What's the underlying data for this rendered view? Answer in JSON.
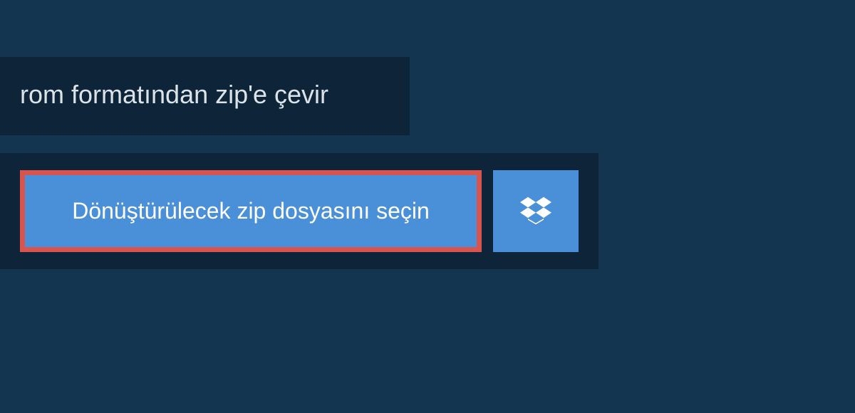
{
  "title": "rom formatından zip'e çevir",
  "upload": {
    "select_file_label": "Dönüştürülecek zip dosyasını seçin",
    "dropbox_icon": "dropbox-icon"
  },
  "colors": {
    "background_outer": "#14354f",
    "background_panel": "#0e2438",
    "button_primary": "#4a90d9",
    "button_border_highlight": "#d9534f",
    "text_light": "#dce3e8",
    "text_white": "#ffffff"
  }
}
